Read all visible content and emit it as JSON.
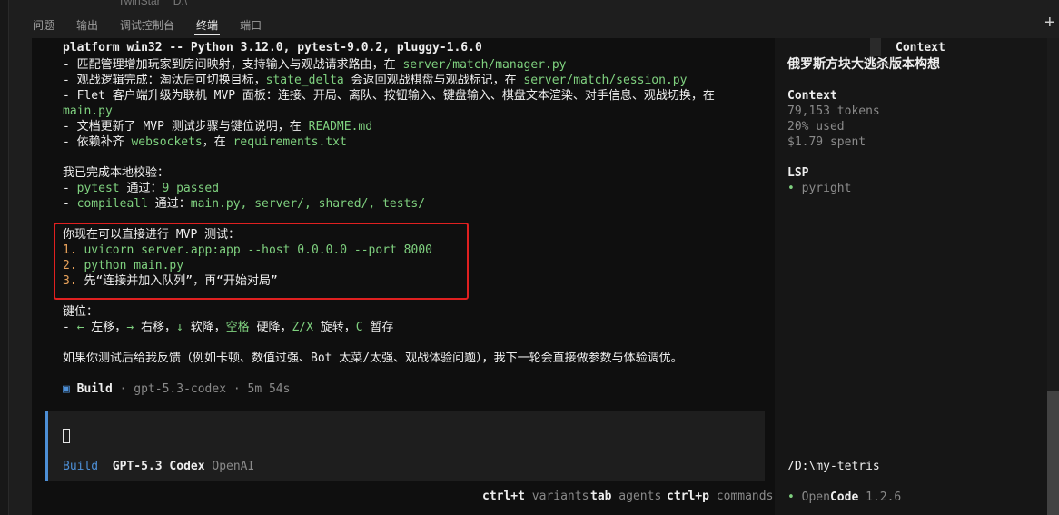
{
  "top_ghost": {
    "left": "TwinStar",
    "right": "D:\\"
  },
  "panel_tabs": [
    "问题",
    "输出",
    "调试控制台",
    "终端",
    "端口"
  ],
  "plus_icon": "+",
  "terminal": {
    "platform_line": "platform win32 -- Python 3.12.0, pytest-9.0.2, pluggy-1.6.0",
    "bullets": [
      {
        "pre": "- 匹配管理增加玩家到房间映射，支持输入与观战请求路由，在 ",
        "path": "server/match/manager.py",
        "post": ""
      },
      {
        "pre": "- 观战逻辑完成：淘汰后可切换目标，",
        "code": "state_delta",
        "mid": " 会返回观战棋盘与观战标记，在 ",
        "path": "server/match/session.py"
      },
      {
        "pre": "- Flet 客户端升级为联机 MVP 面板：连接、开局、离队、按钮输入、键盘输入、棋盘文本渲染、对手信息、观战切换，在",
        "path": "main.py"
      },
      {
        "pre": "- 文档更新了 MVP 测试步骤与键位说明，在 ",
        "path": "README.md"
      },
      {
        "pre": "- 依赖补齐 ",
        "code": "websockets",
        "mid": "，在 ",
        "path": "requirements.txt"
      }
    ],
    "check_title": "我已完成本地校验：",
    "checks": [
      {
        "cmd": "pytest",
        "label": " 通过：",
        "result": "9 passed"
      },
      {
        "cmd": "compileall",
        "label": " 通过：",
        "result": "main.py, server/, shared/, tests/"
      }
    ],
    "mvp_title": "你现在可以直接进行 MVP 测试：",
    "steps": [
      {
        "num": "1.",
        "text": "uvicorn server.app:app --host 0.0.0.0 --port 8000"
      },
      {
        "num": "2.",
        "text": "python main.py"
      },
      {
        "num": "3.",
        "text": "先“连接并加入队列”，再“开始对局”"
      }
    ],
    "keys_title": "键位：",
    "keys": {
      "dash": "- ",
      "left_key": "←",
      "left_label": " 左移，",
      "right_key": "→",
      "right_label": " 右移，",
      "down_key": "↓",
      "down_label": " 软降，",
      "space_key": "空格",
      "space_label": " 硬降，",
      "zx_key": "Z/X",
      "zx_label": " 旋转，",
      "c_key": "C",
      "c_label": " 暂存"
    },
    "feedback": "如果你测试后给我反馈（例如卡顿、数值过强、Bot 太菜/太强、观战体验问题），我下一轮会直接做参数与体验调优。",
    "build_status": {
      "icon": "▣",
      "mode": "Build",
      "model": " · gpt-5.3-codex · 5m 54s"
    }
  },
  "input": {
    "mode": "Build",
    "model": "GPT-5.3 Codex",
    "provider": "OpenAI"
  },
  "footer": [
    {
      "key": "ctrl+t",
      "label": " variants"
    },
    {
      "key": "tab",
      "label": " agents"
    },
    {
      "key": "ctrl+p",
      "label": " commands"
    }
  ],
  "sidebar": {
    "top_label": "Context",
    "title": "俄罗斯方块大逃杀版本构想",
    "context_heading": "Context",
    "tokens": "79,153 tokens",
    "used": "20% used",
    "spent": "$1.79 spent",
    "lsp_heading": "LSP",
    "lsp_bullet": "•",
    "lsp_item": " pyright",
    "path": "/D:\\my-tetris",
    "brand_bullet": "•",
    "brand_open": "Open",
    "brand_code": "Code",
    "version": " 1.2.6"
  },
  "colors": {
    "accent": "#4d8fd6",
    "green": "#7fd17f",
    "orange": "#e7a15a",
    "red_box": "#e02020"
  }
}
